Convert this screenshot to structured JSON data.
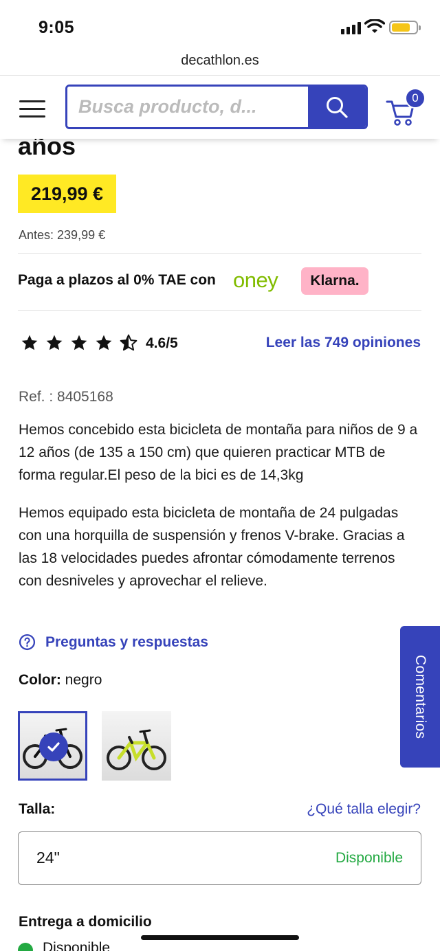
{
  "status_bar": {
    "time": "9:05"
  },
  "browser": {
    "url": "decathlon.es"
  },
  "header": {
    "search_placeholder": "Busca producto, d...",
    "cart_count": "0"
  },
  "product": {
    "title_tail": "años",
    "price": "219,99 €",
    "before_price": "Antes: 239,99 €",
    "installments_text": "Paga a plazos al 0% TAE con",
    "oney_label": "oney",
    "klarna_label": "Klarna.",
    "rating_value": 4.6,
    "rating_text": "4.6/5",
    "reviews_link": "Leer las 749 opiniones",
    "ref": "Ref. : 8405168",
    "description_1": "Hemos concebido esta bicicleta de montaña para niños de 9 a 12 años (de 135 a 150 cm) que quieren practicar MTB de forma regular.El peso de la bici es de 14,3kg",
    "description_2": "Hemos equipado esta bicicleta de montaña de 24 pulgadas con una horquilla de suspensión y frenos V-brake. Gracias a las 18 velocidades puedes afrontar cómodamente terrenos con desniveles y aprovechar el relieve.",
    "qa_link": "Preguntas y respuestas",
    "color_label": "Color:",
    "color_value": "negro",
    "size_label": "Talla:",
    "size_guide_link": "¿Qué talla elegir?",
    "size_value": "24\"",
    "size_availability": "Disponible",
    "delivery_title": "Entrega a domicilio",
    "delivery_status": "Disponible"
  },
  "feedback_tab": "Comentarios",
  "colors": {
    "accent": "#3643ba",
    "price_bg": "#ffe924",
    "available": "#23a942",
    "oney": "#81bc00",
    "klarna_bg": "#ffb3c7"
  }
}
